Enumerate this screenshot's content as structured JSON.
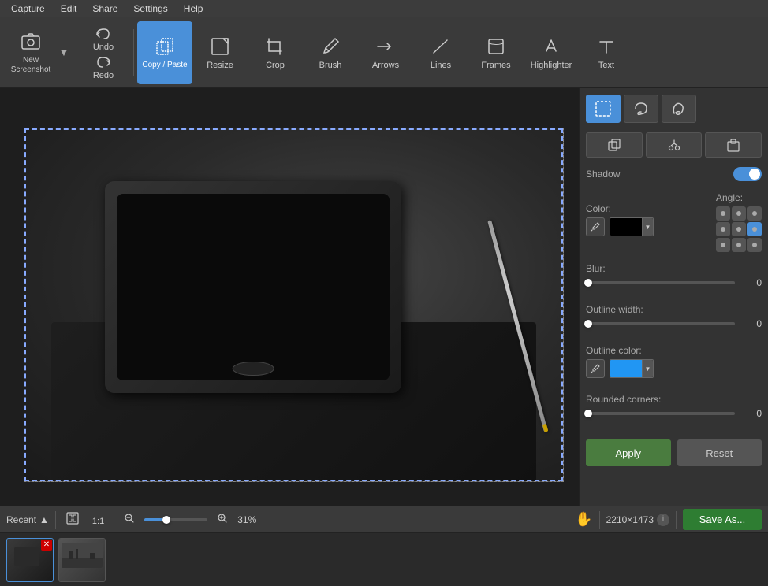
{
  "menubar": {
    "items": [
      "Capture",
      "Edit",
      "Share",
      "Settings",
      "Help"
    ]
  },
  "toolbar": {
    "new_screenshot_label": "New Screenshot",
    "undo_label": "Undo",
    "redo_label": "Redo",
    "copy_paste_label": "Copy / Paste",
    "resize_label": "Resize",
    "crop_label": "Crop",
    "brush_label": "Brush",
    "arrows_label": "Arrows",
    "lines_label": "Lines",
    "frames_label": "Frames",
    "highlighter_label": "Highlighter",
    "text_label": "Text"
  },
  "right_panel": {
    "shadow_label": "Shadow",
    "color_label": "Color:",
    "angle_label": "Angle:",
    "blur_label": "Blur:",
    "blur_value": "0",
    "outline_width_label": "Outline width:",
    "outline_width_value": "0",
    "outline_color_label": "Outline color:",
    "rounded_corners_label": "Rounded corners:",
    "rounded_corners_value": "0",
    "apply_label": "Apply",
    "reset_label": "Reset",
    "shadow_enabled": true,
    "shadow_color": "#000000",
    "outline_color": "#2196F3"
  },
  "status_bar": {
    "recent_label": "Recent",
    "zoom_level": "31%",
    "ratio_label": "1:1",
    "dimensions": "2210×1473",
    "save_as_label": "Save As..."
  },
  "thumbnails": [
    {
      "id": 1,
      "active": true,
      "has_close": true
    },
    {
      "id": 2,
      "active": false,
      "has_close": false
    }
  ]
}
